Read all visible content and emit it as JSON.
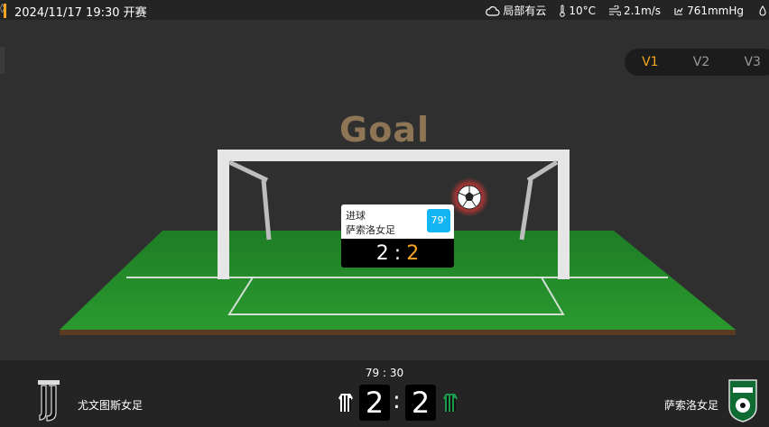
{
  "header": {
    "datetime": "2024/11/17 19:30 开赛",
    "weather": {
      "condition": "局部有云",
      "temperature": "10°C",
      "wind": "2.1m/s",
      "pressure": "761mmHg"
    }
  },
  "versions": {
    "items": [
      "V1",
      "V2",
      "V3"
    ],
    "active": "V1"
  },
  "field": {
    "event_title": "Goal"
  },
  "event_popup": {
    "type": "进球",
    "team": "萨索洛女足",
    "minute": "79'",
    "home_score": "2",
    "away_score": "2",
    "separator": ":"
  },
  "match": {
    "clock": "79 : 30",
    "home_team": "尤文图斯女足",
    "away_team": "萨索洛女足",
    "home_score": "2",
    "away_score": "2",
    "separator": ":"
  },
  "icons": {
    "weather": "cloud-icon",
    "temperature": "thermometer-icon",
    "wind": "wind-icon",
    "pressure": "droplet-icon",
    "ball": "soccer-ball-icon"
  },
  "colors": {
    "accent": "#f5a623",
    "minute_badge": "#12b6f5",
    "pitch": "#1f8a2a",
    "goal_text": "#8d7556",
    "home_kit": "#ffffff",
    "away_kit": "#1a9a4a"
  }
}
